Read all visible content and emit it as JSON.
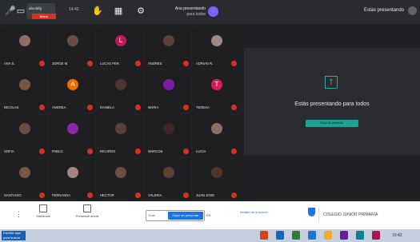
{
  "topbar": {
    "sel_label": "abcdefg",
    "raise_label": "Mano",
    "small_count": "14:42",
    "presenter_name": "Ana presentando",
    "presenter_sub": "para todos",
    "right_label": "Estás presentando"
  },
  "participants": [
    {
      "name": "ANA S.",
      "color": "#8d6e63",
      "letter": ""
    },
    {
      "name": "JORGE M.",
      "color": "#6d4c41",
      "letter": ""
    },
    {
      "name": "LUCAS PER.",
      "color": "#c2185b",
      "letter": "L"
    },
    {
      "name": "ANDRES",
      "color": "#5d4037",
      "letter": ""
    },
    {
      "name": "ADRIAN R.",
      "color": "#a1887f",
      "letter": ""
    },
    {
      "name": "NICOLAS",
      "color": "#795548",
      "letter": ""
    },
    {
      "name": "ANDREA",
      "color": "#ef6c00",
      "letter": "A"
    },
    {
      "name": "DANIELA",
      "color": "#4e342e",
      "letter": ""
    },
    {
      "name": "MARIA",
      "color": "#7b1fa2",
      "letter": ""
    },
    {
      "name": "TERESA",
      "color": "#d81b60",
      "letter": "T"
    },
    {
      "name": "SOFIA",
      "color": "#6d4c41",
      "letter": ""
    },
    {
      "name": "PABLO",
      "color": "#8e24aa",
      "letter": ""
    },
    {
      "name": "RICARDO",
      "color": "#5d4037",
      "letter": ""
    },
    {
      "name": "MARCOS",
      "color": "#3e2723",
      "letter": ""
    },
    {
      "name": "LUCIA",
      "color": "#8d6e63",
      "letter": ""
    },
    {
      "name": "SANTIAGO",
      "color": "#795548",
      "letter": ""
    },
    {
      "name": "FERNANDA",
      "color": "#a1887f",
      "letter": ""
    },
    {
      "name": "HECTOR",
      "color": "#6d4c41",
      "letter": ""
    },
    {
      "name": "VALERIA",
      "color": "#5d4037",
      "letter": ""
    },
    {
      "name": "JUAN JOSE",
      "color": "#4e342e",
      "letter": ""
    }
  ],
  "presenting": {
    "message": "Estás presentando para todos",
    "button": "Dejar de presentar"
  },
  "meetbar": {
    "item1": "Subtítulos",
    "item2": "Presentar ahora",
    "pill_left": "Grab",
    "pill_right": "Dejar de presentar",
    "lang": "ES",
    "link": "Detalles de la reunión",
    "meeting": "COLEGIO JUNIOR PRIMARIA"
  },
  "taskbar": {
    "start": "Escribe aquí para buscar",
    "tray": "10:42"
  }
}
